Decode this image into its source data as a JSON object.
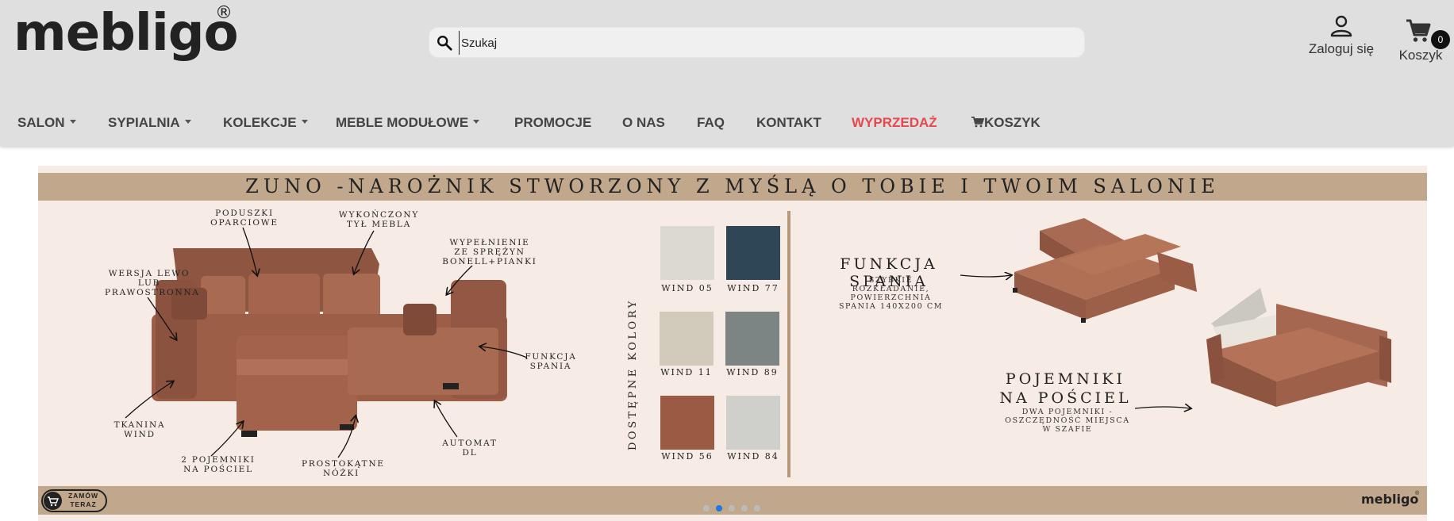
{
  "header": {
    "logo": "mebligo",
    "logo_mark": "®",
    "search": {
      "placeholder": "Szukaj",
      "icon": "search-icon"
    },
    "account_label": "Zaloguj się",
    "cart_label": "Koszyk",
    "cart_count": "0"
  },
  "nav": [
    {
      "label": "SALON",
      "dropdown": true
    },
    {
      "label": "SYPIALNIA",
      "dropdown": true
    },
    {
      "label": "KOLEKCJE",
      "dropdown": true
    },
    {
      "label": "MEBLE MODUŁOWE",
      "dropdown": true
    },
    {
      "label": "PROMOCJE",
      "dropdown": false
    },
    {
      "label": "O NAS",
      "dropdown": false
    },
    {
      "label": "FAQ",
      "dropdown": false
    },
    {
      "label": "KONTAKT",
      "dropdown": false
    },
    {
      "label": "WYPRZEDAŻ",
      "dropdown": false,
      "color": "#e5484d"
    },
    {
      "label": "KOSZYK",
      "dropdown": false,
      "icon": "cart-icon"
    }
  ],
  "banner": {
    "title": "ZUNO -NAROŻNIK STWORZONY Z MYŚLĄ O TOBIE I TWOIM SALONIE",
    "features": {
      "poduszki": "PODUSZKI OPARCIOWE",
      "wykonczony": "WYKOŃCZONY TYŁ MEBLA",
      "wypelnienie": "WYPEŁNIENIE ZE SPRĘŻYN BONELL+PIANKI",
      "wersja": "WERSJA LEWO LUB PRAWOSTRONNA",
      "funkcja": "FUNKCJA SPANIA",
      "tkanina": "TKANINA WIND",
      "pojemniki": "2 POJEMNIKI NA POŚCIEL",
      "nozki": "PROSTOKĄTNE NÓŻKI",
      "automat": "AUTOMAT DL"
    },
    "colors_label": "DOSTĘPNE KOLORY",
    "swatches": [
      {
        "name": "WIND 05",
        "color": "#dcd9d2"
      },
      {
        "name": "WIND 77",
        "color": "#2f4657"
      },
      {
        "name": "WIND 11",
        "color": "#d2cabb"
      },
      {
        "name": "WIND 89",
        "color": "#7d8584"
      },
      {
        "name": "WIND 56",
        "color": "#9a5b42"
      },
      {
        "name": "WIND 84",
        "color": "#cfcfcc"
      }
    ],
    "sleep": {
      "title": "FUNKCJA SPANIA",
      "sub": "SZYBKIE ROZKŁADANIE, POWIERZCHNIA SPANIA 140X200 CM"
    },
    "storage": {
      "title": "POJEMNIKI NA POŚCIEL",
      "sub": "DWA POJEMNIKI - OSZCZĘDNOŚĆ MIEJSCA W SZAFIE"
    },
    "order_button": "ZAMÓW TERAZ",
    "brand": "mebligo",
    "slides": 5,
    "active_slide": 2
  },
  "colors": {
    "header_bg": "#dfdfdf",
    "banner_bg": "#f7ebe5",
    "bar": "#c1a78c",
    "sofa": "#a3634a",
    "accent_sale": "#e5484d"
  }
}
